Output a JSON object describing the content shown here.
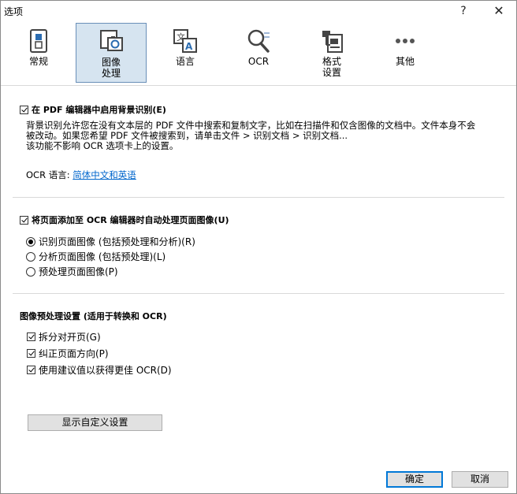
{
  "window": {
    "title": "选项",
    "help_glyph": "?",
    "close_glyph": "✕"
  },
  "toolbar": {
    "items": [
      {
        "label": "常规",
        "icon": "switch-icon"
      },
      {
        "label": "图像\n处理",
        "icon": "image-processing-icon"
      },
      {
        "label": "语言",
        "icon": "language-icon"
      },
      {
        "label": "OCR",
        "icon": "ocr-magnifier-icon"
      },
      {
        "label": "格式\n设置",
        "icon": "format-settings-icon"
      },
      {
        "label": "其他",
        "icon": "more-dots-icon"
      }
    ],
    "selected_index": 1
  },
  "section1": {
    "checkbox_label": "在 PDF 编辑器中启用背景识别(E)",
    "checked": true,
    "desc_line1": "背景识别允许您在没有文本层的 PDF 文件中搜索和复制文字，比如在扫描件和仅含图像的文档中。文件本身不会",
    "desc_line2": "被改动。如果您希望 PDF 文件被搜索到，请单击文件 > 识别文档 > 识别文档...",
    "desc_line3": "该功能不影响 OCR 选项卡上的设置。",
    "ocr_lang_label": "OCR 语言:",
    "ocr_lang_value": "简体中文和英语"
  },
  "section2": {
    "checkbox_label": "将页面添加至 OCR 编辑器时自动处理页面图像(U)",
    "checked": true,
    "radios": [
      {
        "label": "识别页面图像 (包括预处理和分析)(R)",
        "checked": true
      },
      {
        "label": "分析页面图像 (包括预处理)(L)",
        "checked": false
      },
      {
        "label": "预处理页面图像(P)",
        "checked": false
      }
    ]
  },
  "section3": {
    "title": "图像预处理设置 (适用于转换和 OCR)",
    "checkboxes": [
      {
        "label": "拆分对开页(G)",
        "checked": true
      },
      {
        "label": "纠正页面方向(P)",
        "checked": true
      },
      {
        "label": "使用建议值以获得更佳 OCR(D)",
        "checked": true
      }
    ],
    "custom_button": "显示自定义设置"
  },
  "footer": {
    "ok": "确定",
    "cancel": "取消"
  }
}
